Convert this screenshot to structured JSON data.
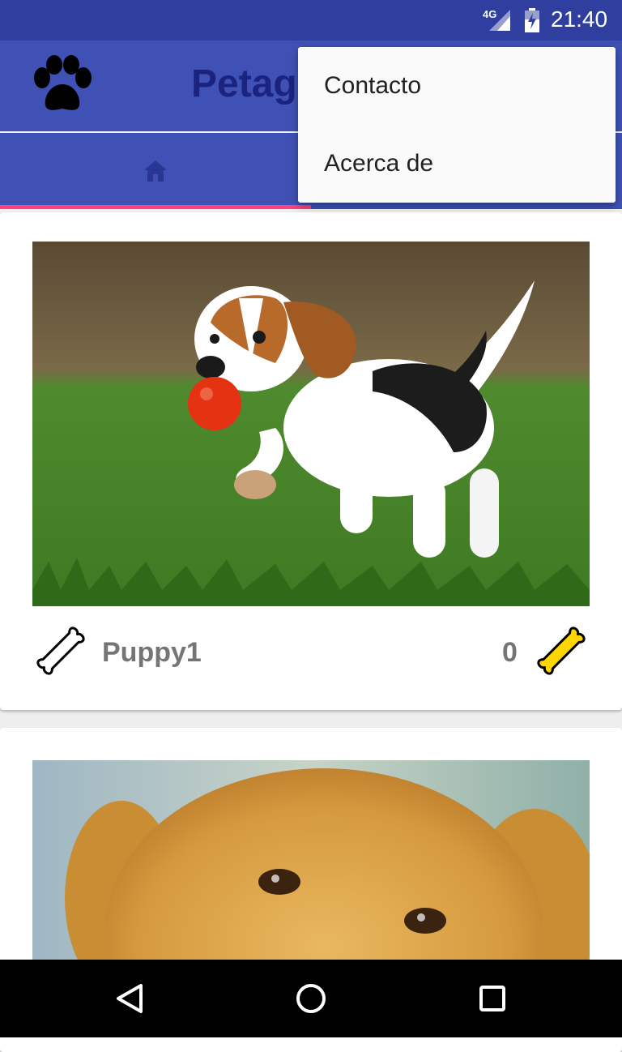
{
  "status_bar": {
    "network_label": "4G",
    "time": "21:40"
  },
  "app_bar": {
    "title": "Petagram",
    "logo_icon": "paw-icon"
  },
  "tabs": [
    {
      "icon": "home-icon",
      "selected": true
    },
    {
      "icon": "",
      "selected": false
    }
  ],
  "overflow_menu": {
    "items": [
      {
        "label": "Contacto"
      },
      {
        "label": "Acerca de"
      }
    ]
  },
  "pets": [
    {
      "name": "Puppy1",
      "likes": "0",
      "photo": "beagle puppy with red ball on grass"
    },
    {
      "photo": "golden retriever puppy face"
    }
  ],
  "colors": {
    "primary": "#3f51b5",
    "primary_dark": "#303f9f",
    "accent": "#ff4081",
    "bone_like": "#ffd600"
  },
  "nav_bar": {
    "icons": [
      "back-icon",
      "home-circle-icon",
      "recents-icon"
    ]
  }
}
